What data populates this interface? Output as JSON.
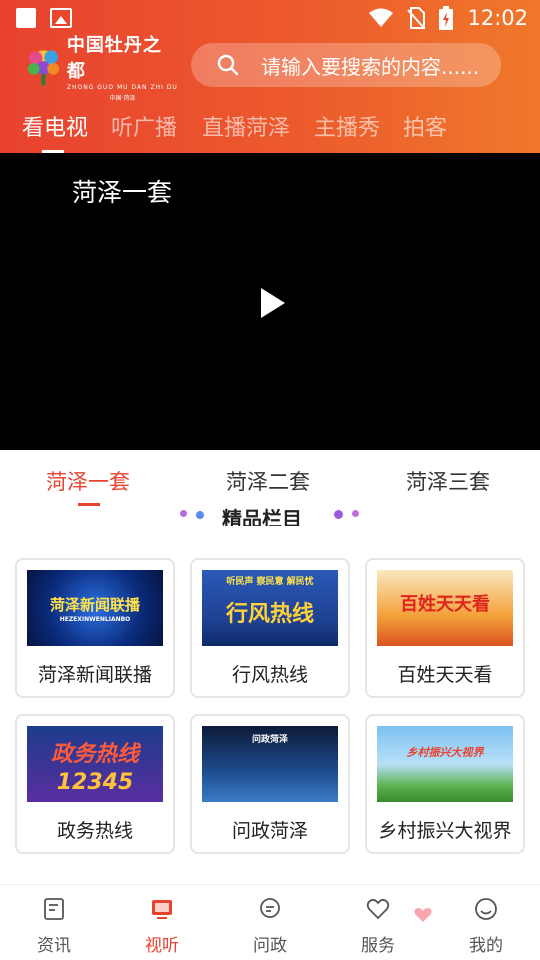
{
  "status_bar": {
    "time": "12:02"
  },
  "brand": {
    "title": "中国牡丹之都",
    "subtitle": "ZHONG GUO MU DAN ZHI DU",
    "location": "中国·菏泽"
  },
  "search": {
    "placeholder": "请输入要搜索的内容......"
  },
  "top_tabs": [
    {
      "label": "看电视",
      "active": true
    },
    {
      "label": "听广播",
      "active": false
    },
    {
      "label": "直播菏泽",
      "active": false
    },
    {
      "label": "主播秀",
      "active": false
    },
    {
      "label": "拍客",
      "active": false
    }
  ],
  "player": {
    "channel_title": "菏泽一套"
  },
  "channels": [
    {
      "label": "菏泽一套",
      "active": true
    },
    {
      "label": "菏泽二套",
      "active": false
    },
    {
      "label": "菏泽三套",
      "active": false
    }
  ],
  "section": {
    "title": "精品栏目"
  },
  "programs": [
    {
      "label": "菏泽新闻联播",
      "thumb_text": "菏泽新闻联播",
      "thumb_sub": "HEZEXINWENLIANBO"
    },
    {
      "label": "行风热线",
      "thumb_text": "行风热线",
      "thumb_sub": "听民声 察民意 解民忧"
    },
    {
      "label": "百姓天天看",
      "thumb_text": "百姓天天看",
      "thumb_sub": ""
    },
    {
      "label": "政务热线",
      "thumb_text": "政务热线",
      "thumb_sub": "12345"
    },
    {
      "label": "问政菏泽",
      "thumb_text": "问政菏泽",
      "thumb_sub": ""
    },
    {
      "label": "乡村振兴大视界",
      "thumb_text": "乡村振兴大视界",
      "thumb_sub": ""
    }
  ],
  "bottom_nav": [
    {
      "label": "资讯",
      "icon": "news-icon",
      "active": false
    },
    {
      "label": "视听",
      "icon": "tv-icon",
      "active": true
    },
    {
      "label": "问政",
      "icon": "chat-icon",
      "active": false
    },
    {
      "label": "服务",
      "icon": "heart-icon",
      "active": false
    },
    {
      "label": "我的",
      "icon": "profile-icon",
      "active": false
    }
  ],
  "colors": {
    "brand": "#e8432f",
    "header_end": "#f0782b"
  }
}
